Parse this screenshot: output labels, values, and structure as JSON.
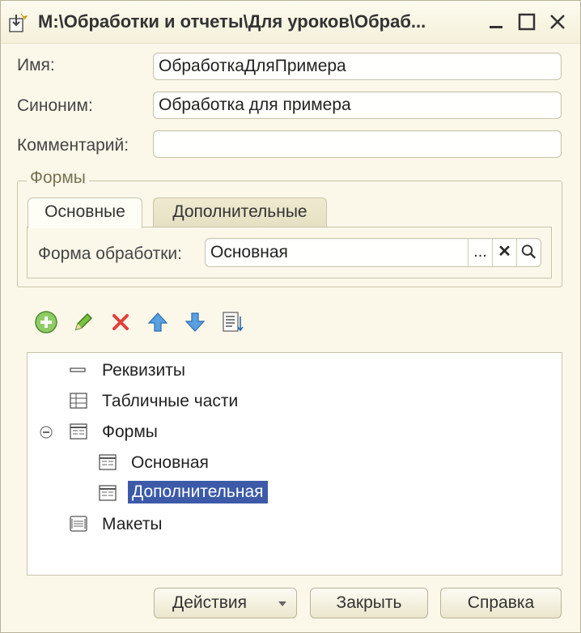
{
  "window": {
    "title": "М:\\Обработки и отчеты\\Для уроков\\Обраб..."
  },
  "fields": {
    "name_label": "Имя:",
    "name_value": "ОбработкаДляПримера",
    "synonym_label": "Синоним:",
    "synonym_value": "Обработка для примера",
    "comment_label": "Комментарий:",
    "comment_value": ""
  },
  "forms_group": {
    "title": "Формы",
    "tabs": [
      {
        "label": "Основные",
        "active": true
      },
      {
        "label": "Дополнительные",
        "active": false
      }
    ],
    "form_label": "Форма обработки:",
    "form_value": "Основная",
    "select_button": "...",
    "clear_button": "✕"
  },
  "toolbar": {
    "icons": [
      "add-icon",
      "edit-pencil-icon",
      "delete-icon",
      "move-up-icon",
      "move-down-icon",
      "sort-list-icon"
    ]
  },
  "tree": {
    "items": [
      {
        "label": "Реквизиты",
        "icon": "attributes-icon",
        "level": 0
      },
      {
        "label": "Табличные части",
        "icon": "table-parts-icon",
        "level": 0
      },
      {
        "label": "Формы",
        "icon": "forms-icon",
        "level": 0,
        "expanded": true
      },
      {
        "label": "Основная",
        "icon": "form-icon",
        "level": 1
      },
      {
        "label": "Дополнительная",
        "icon": "form-icon",
        "level": 1,
        "selected": true
      },
      {
        "label": "Макеты",
        "icon": "templates-icon",
        "level": 0
      }
    ]
  },
  "buttons": {
    "actions": "Действия",
    "close": "Закрыть",
    "help": "Справка"
  },
  "colors": {
    "background": "#fbf8ea",
    "selection": "#3c5aa8"
  }
}
